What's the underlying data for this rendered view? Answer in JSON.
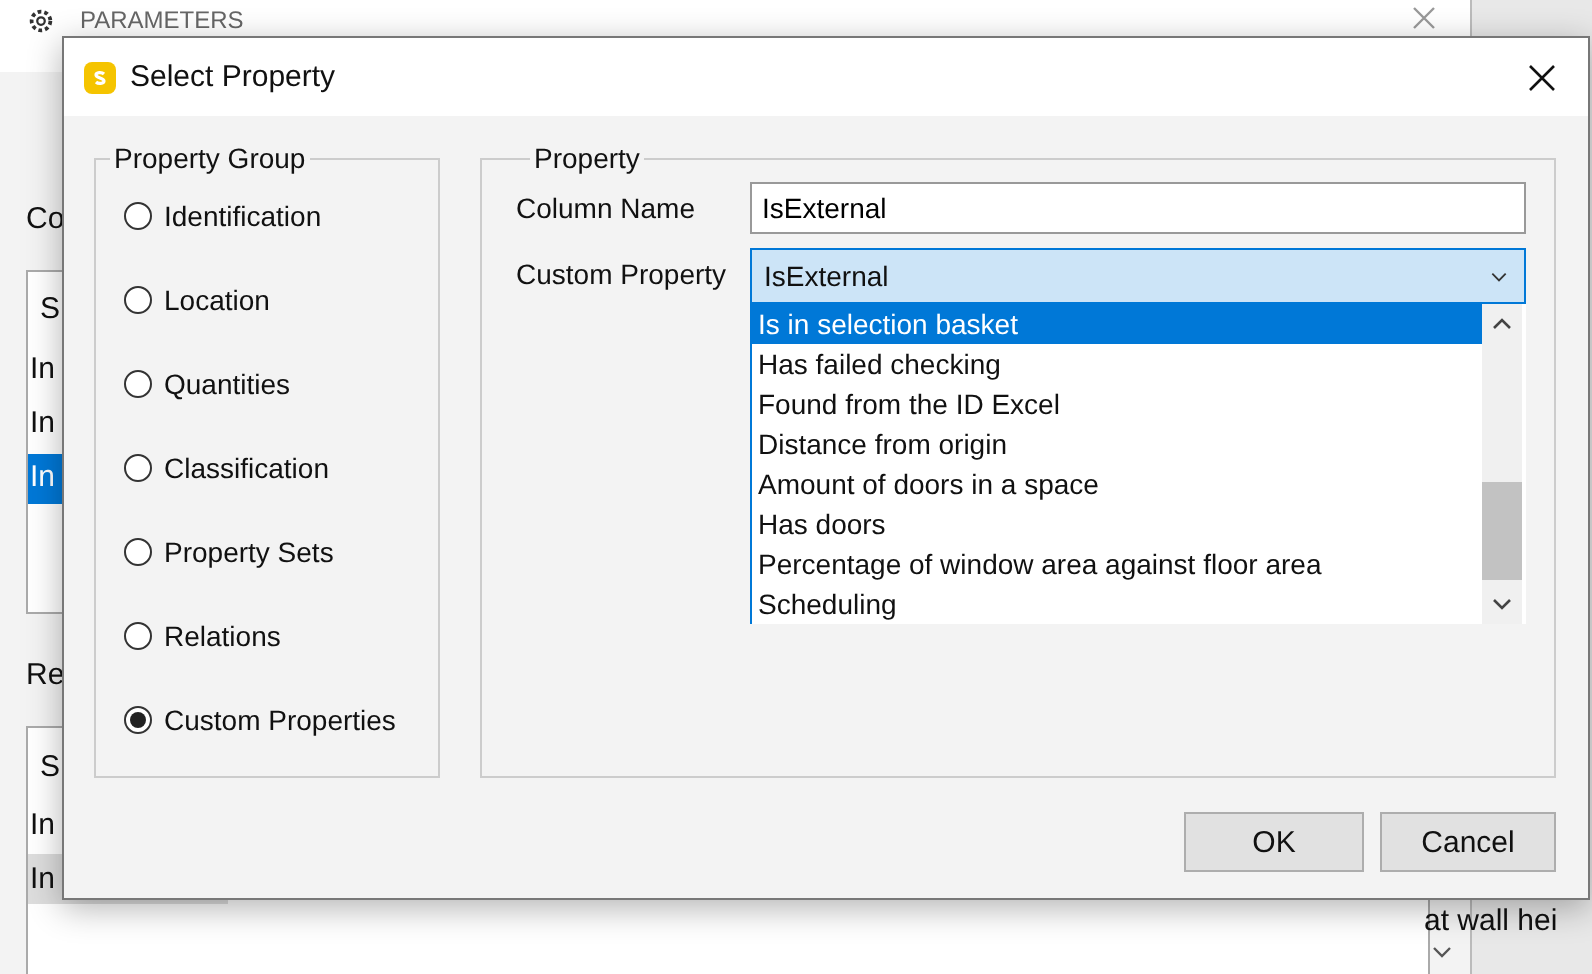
{
  "background_window": {
    "title": "PARAMETERS",
    "texts": [
      {
        "kind": "label",
        "text": "Co"
      },
      {
        "kind": "header",
        "text": "S"
      },
      {
        "kind": "row",
        "text": "In"
      },
      {
        "kind": "row",
        "text": "In"
      },
      {
        "kind": "selrow",
        "text": "In"
      },
      {
        "kind": "label",
        "text": "Re"
      },
      {
        "kind": "header",
        "text": "S"
      },
      {
        "kind": "row",
        "text": "In"
      },
      {
        "kind": "row",
        "text": "In"
      },
      {
        "kind": "label",
        "text": "at wall hei"
      }
    ]
  },
  "dialog": {
    "title": "Select Property",
    "property_group": {
      "label": "Property Group",
      "options": [
        {
          "label": "Identification",
          "selected": false
        },
        {
          "label": "Location",
          "selected": false
        },
        {
          "label": "Quantities",
          "selected": false
        },
        {
          "label": "Classification",
          "selected": false
        },
        {
          "label": "Property Sets",
          "selected": false
        },
        {
          "label": "Relations",
          "selected": false
        },
        {
          "label": "Custom Properties",
          "selected": true
        }
      ]
    },
    "property": {
      "label": "Property",
      "column_name": {
        "label": "Column Name",
        "value": "IsExternal"
      },
      "custom_property": {
        "label": "Custom Property",
        "value": "IsExternal",
        "expanded": true,
        "items": [
          {
            "label": "Is in selection basket",
            "selected": true
          },
          {
            "label": "Has failed checking",
            "selected": false
          },
          {
            "label": "Found from the ID Excel",
            "selected": false
          },
          {
            "label": "Distance from origin",
            "selected": false
          },
          {
            "label": "Amount of doors in a space",
            "selected": false
          },
          {
            "label": "Has doors",
            "selected": false
          },
          {
            "label": "Percentage of window area against floor area",
            "selected": false
          },
          {
            "label": "Scheduling",
            "selected": false
          }
        ]
      }
    },
    "buttons": [
      "OK",
      "Cancel"
    ]
  }
}
